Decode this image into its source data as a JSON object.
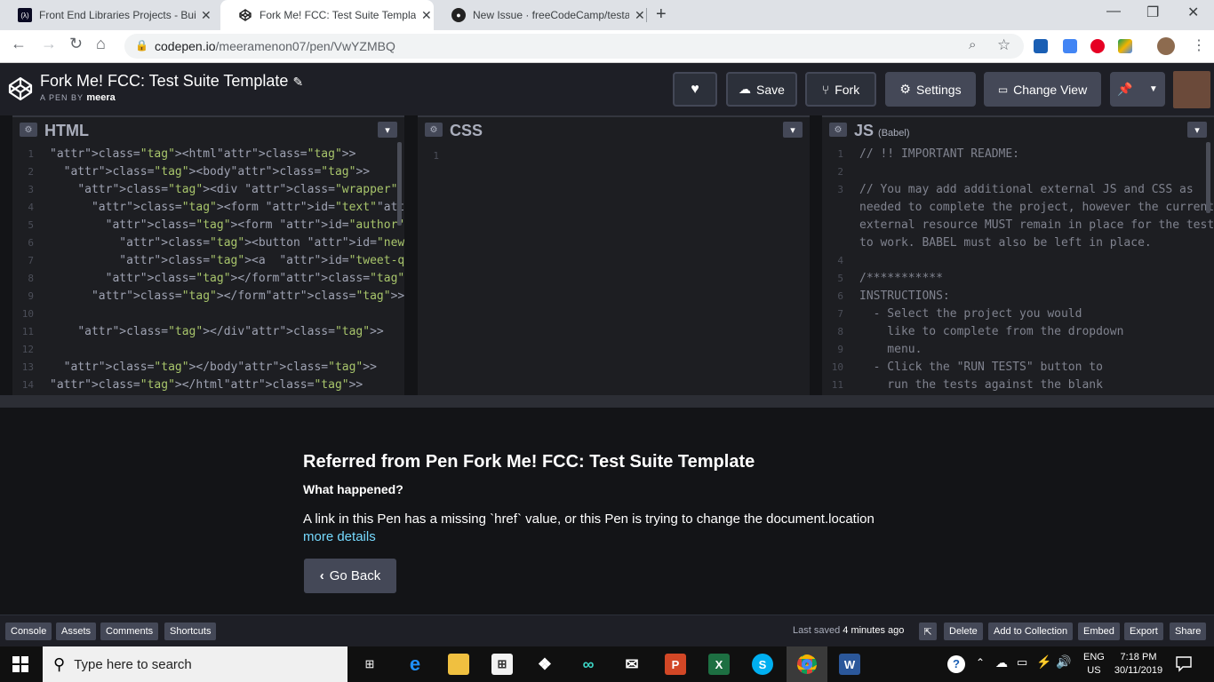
{
  "browser": {
    "tabs": [
      {
        "title": "Front End Libraries Projects - Buil",
        "icon": "fcc-icon"
      },
      {
        "title": "Fork Me! FCC: Test Suite Templat",
        "icon": "codepen-icon"
      },
      {
        "title": "New Issue · freeCodeCamp/testal",
        "icon": "github-icon"
      }
    ],
    "url_host": "codepen.io",
    "url_path": "/meeramenon07/pen/VwYZMBQ"
  },
  "pen": {
    "title": "Fork Me! FCC: Test Suite Template",
    "by_label": "A PEN BY",
    "author": "meera"
  },
  "header_buttons": {
    "save": "Save",
    "fork": "Fork",
    "settings": "Settings",
    "change_view": "Change View"
  },
  "panes": {
    "html": {
      "name": "HTML"
    },
    "css": {
      "name": "CSS"
    },
    "js": {
      "name": "JS",
      "sub": "(Babel)"
    }
  },
  "html_code": [
    "<html>",
    "  <body>",
    "    <div class=\"wrapper\" id=\"quote-box\">",
    "      <form id=\"text\">",
    "        <form id=\"author\">",
    "          <button id=\"new-quote\">New quote</button>",
    "          <a  id=\"tweet-quote\">Tweet this quote</a>",
    "        </form>",
    "      </form>",
    "",
    "    </div>",
    "",
    "  </body>",
    "</html>"
  ],
  "css_code": [
    ""
  ],
  "js_code": [
    "// !! IMPORTANT README:",
    "",
    "// You may add additional external JS and CSS as",
    "needed to complete the project, however the current",
    "external resource MUST remain in place for the tests",
    "to work. BABEL must also be left in place.",
    "",
    "/***********",
    "INSTRUCTIONS:",
    "  - Select the project you would",
    "    like to complete from the dropdown",
    "    menu.",
    "  - Click the \"RUN TESTS\" button to",
    "    run the tests against the blank"
  ],
  "js_line_numbers": [
    "1",
    "2",
    "3",
    "",
    "",
    "",
    "4",
    "5",
    "6",
    "7",
    "8",
    "9",
    "10",
    "11"
  ],
  "result": {
    "title": "Referred from Pen Fork Me! FCC: Test Suite Template",
    "question": "What happened?",
    "message": "A link in this Pen has a missing `href` value, or this Pen is trying to change the document.location",
    "more_link": "more details",
    "back_button": "Go Back"
  },
  "footer": {
    "console": "Console",
    "assets": "Assets",
    "comments": "Comments",
    "shortcuts": "Shortcuts",
    "last_saved_prefix": "Last saved",
    "last_saved_time": "4 minutes ago",
    "delete": "Delete",
    "add_to_collection": "Add to Collection",
    "embed": "Embed",
    "export": "Export",
    "share": "Share"
  },
  "taskbar": {
    "search_placeholder": "Type here to search",
    "lang_line1": "ENG",
    "lang_line2": "US",
    "time": "7:18 PM",
    "date": "30/11/2019"
  },
  "colors": {
    "codepen_bg": "#1e1f26",
    "editor_bg": "#1d1e22",
    "button": "#444857",
    "link": "#76daff"
  }
}
